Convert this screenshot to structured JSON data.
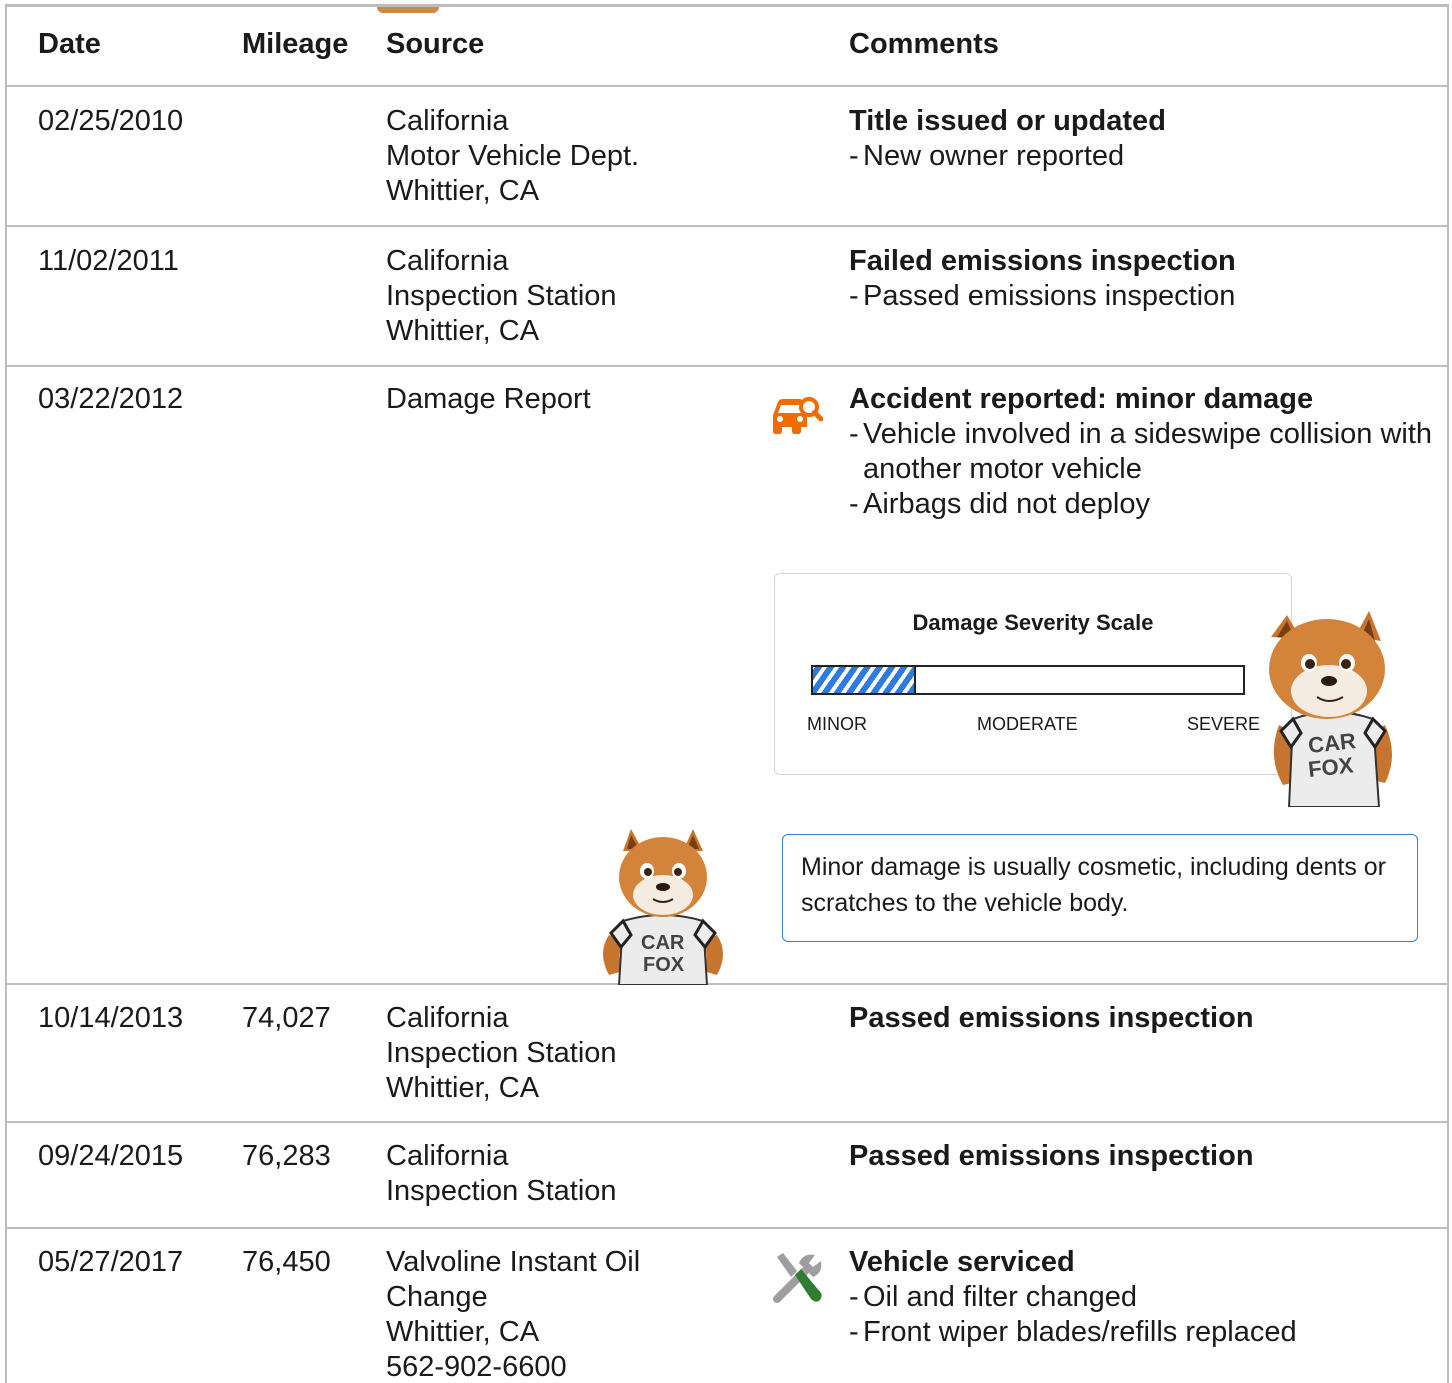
{
  "header": {
    "date": "Date",
    "mileage": "Mileage",
    "source": "Source",
    "comments": "Comments"
  },
  "records": [
    {
      "date": "02/25/2010",
      "mileage": "",
      "source": [
        "California",
        "Motor Vehicle Dept.",
        "Whittier, CA"
      ],
      "title": "Title issued or updated",
      "details": [
        "New owner reported"
      ]
    },
    {
      "date": "11/02/2011",
      "mileage": "",
      "source": [
        "California",
        "Inspection Station",
        "Whittier, CA"
      ],
      "title": "Failed emissions inspection",
      "details": [
        "Passed emissions inspection"
      ]
    },
    {
      "date": "03/22/2012",
      "mileage": "",
      "source": [
        "Damage Report"
      ],
      "title": "Accident reported: minor damage",
      "details": [
        "Vehicle involved in a sideswipe collision with another motor vehicle",
        "Airbags did not deploy"
      ],
      "icon": "car-search-icon"
    },
    {
      "date": "10/14/2013",
      "mileage": "74,027",
      "source": [
        "California",
        "Inspection Station",
        "Whittier, CA"
      ],
      "title": "Passed emissions inspection",
      "details": []
    },
    {
      "date": "09/24/2015",
      "mileage": "76,283",
      "source": [
        "California",
        "Inspection Station"
      ],
      "title": "Passed emissions inspection",
      "details": []
    },
    {
      "date": "05/27/2017",
      "mileage": "76,450",
      "source": [
        "Valvoline Instant Oil",
        "Change",
        "Whittier, CA",
        "562-902-6600"
      ],
      "title": "Vehicle serviced",
      "details": [
        "Oil and filter changed",
        "Front wiper blades/refills replaced"
      ],
      "icon": "wrench-screwdriver-icon"
    }
  ],
  "severity": {
    "title": "Damage Severity Scale",
    "level_fraction": 0.24,
    "labels": {
      "minor": "MINOR",
      "moderate": "MODERATE",
      "severe": "SEVERE"
    },
    "fill_color": "#2d7be0"
  },
  "damage_note": "Minor damage is usually cosmetic, including dents or scratches to the vehicle body.",
  "colors": {
    "accident_icon": "#ef6c00",
    "service_tool_grey": "#9e9e9e",
    "service_tool_green": "#2e7d32",
    "note_border": "#3b7ed8",
    "divider": "#bdbdbd"
  }
}
